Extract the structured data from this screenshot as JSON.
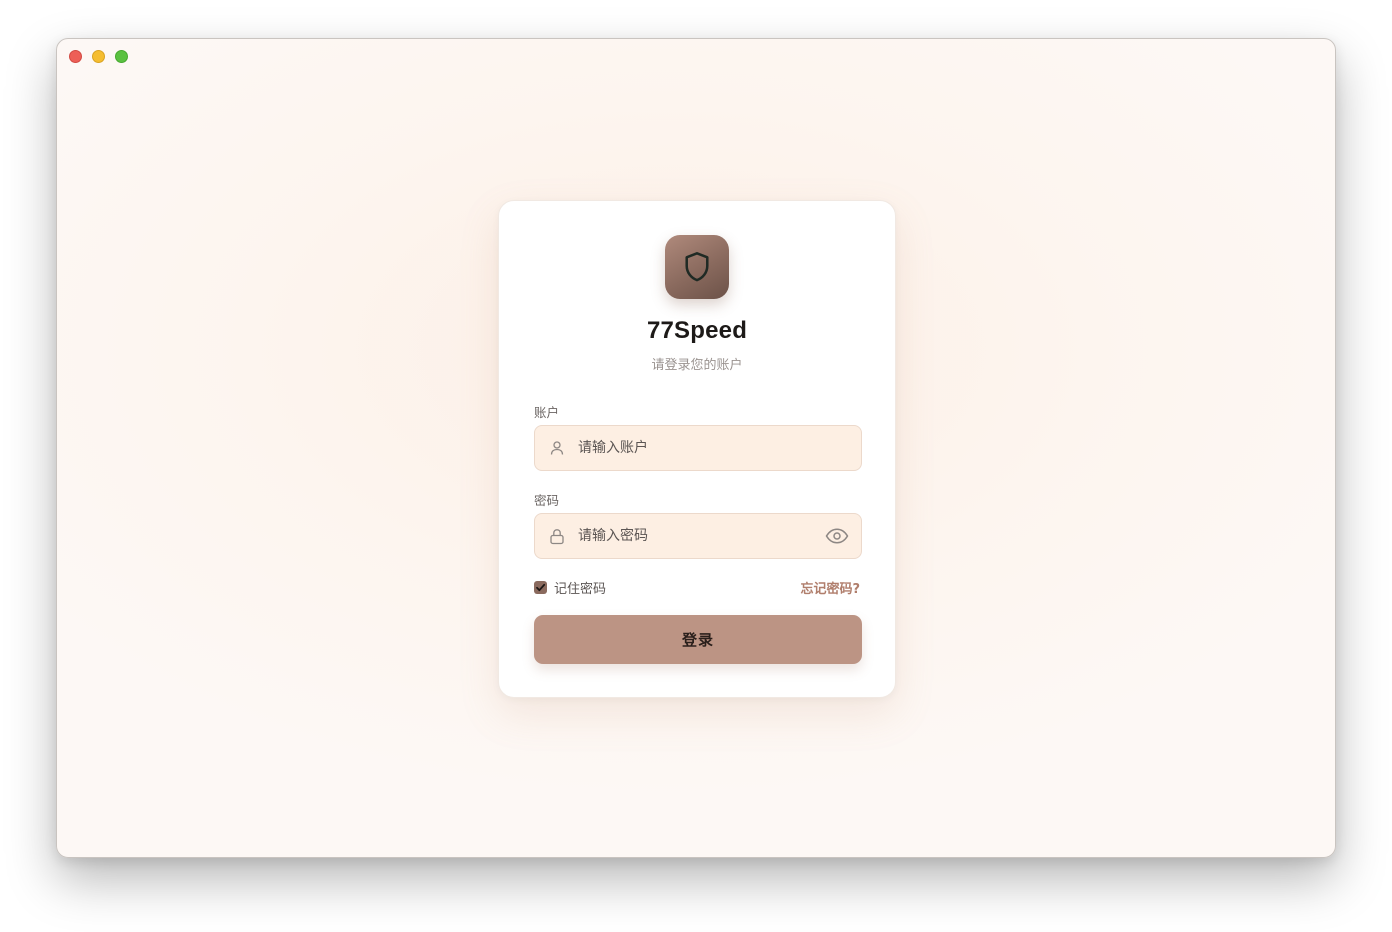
{
  "window": {
    "controls": [
      "close",
      "minimize",
      "maximize"
    ]
  },
  "app": {
    "logo_icon": "shield-icon",
    "name": "77Speed",
    "subtitle": "请登录您的账户"
  },
  "form": {
    "account": {
      "label": "账户",
      "placeholder": "请输入账户",
      "value": "",
      "icon": "user-icon"
    },
    "password": {
      "label": "密码",
      "placeholder": "请输入密码",
      "value": "",
      "icon": "lock-icon",
      "toggle_icon": "eye-icon"
    },
    "remember": {
      "label": "记住密码",
      "checked": true
    },
    "forgot_label": "忘记密码?",
    "submit_label": "登录"
  },
  "colors": {
    "accent": "#bc9484",
    "link": "#b07e6c",
    "input_bg": "#fdefe3",
    "logo": "#8a6a5e"
  }
}
